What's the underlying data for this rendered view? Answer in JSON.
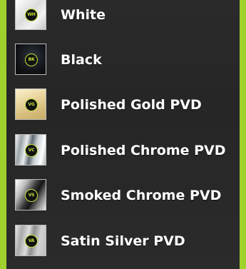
{
  "finishes": [
    {
      "label": "White",
      "code": "WH",
      "swatch": "white-finish"
    },
    {
      "label": "Black",
      "code": "BK",
      "swatch": "black-finish"
    },
    {
      "label": "Polished Gold PVD",
      "code": "VG",
      "swatch": "gold-finish"
    },
    {
      "label": "Polished Chrome PVD",
      "code": "VC",
      "swatch": "chrome-finish"
    },
    {
      "label": "Smoked Chrome PVD",
      "code": "VS",
      "swatch": "smoked-chrome-finish"
    },
    {
      "label": "Satin Silver PVD",
      "code": "VA",
      "swatch": "satin-silver-finish"
    }
  ],
  "colors": {
    "frame": "#9ed12b",
    "panel": "#2a2a2a",
    "badge_accent": "#c3e33a",
    "label": "#ffffff"
  }
}
